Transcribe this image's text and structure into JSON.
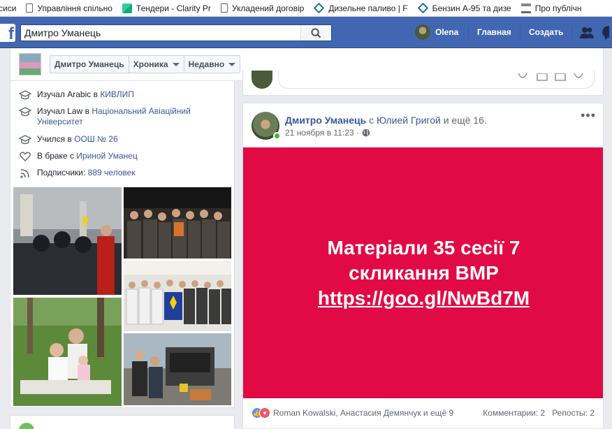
{
  "bookmarks": [
    {
      "label": "сиси",
      "icon": "none"
    },
    {
      "label": "Управління спільно",
      "icon": "doc-icon"
    },
    {
      "label": "Тендери - Clarity Pr",
      "icon": "clarity-icon"
    },
    {
      "label": "Укладений договір",
      "icon": "doc-icon"
    },
    {
      "label": "Дизельне паливо | F",
      "icon": "diamond-icon"
    },
    {
      "label": "Бензин А-95 та дизе",
      "icon": "diamond-icon"
    },
    {
      "label": "Про публічн",
      "icon": "bank-icon"
    }
  ],
  "topbar": {
    "search_value": "Дмитро Уманець",
    "user_name": "Olena",
    "home_label": "Главная",
    "create_label": "Создать"
  },
  "timeline_header": {
    "name_tab": "Дмитро Уманець",
    "chronicle_tab": "Хроника",
    "recent_tab": "Недавно"
  },
  "intro": {
    "row1_prefix": "Изучал Arabic в ",
    "row1_link": "КИВЛИП",
    "row2_prefix": "Изучал Law в ",
    "row2_link": "Національний Авіаційний Університет",
    "row3_prefix": "Учился в ",
    "row3_link": "ООШ № 26",
    "row4_prefix": "В браке с ",
    "row4_link": "Ириной Уманец",
    "row5_prefix": "Подписчики: ",
    "row5_link": "889 человек"
  },
  "post": {
    "author": "Дмитро Уманець",
    "with_text": " с ",
    "tagged": "Юлией Григой",
    "and_more": " и ещё 16.",
    "timestamp": "21 ноября в 11:23 ·",
    "banner_line1": "Матеріали 35 сесії 7",
    "banner_line2": "скликання ВМР",
    "banner_url": "https://goo.gl/NwBd7M",
    "reactors": "Roman Kowalski, Анастасия Демянчук и ещё 9",
    "comments": "Комментарии: 2",
    "shares": "Репосты: 2"
  },
  "colors": {
    "fb_blue": "#4267b2",
    "banner_red": "#e10a44",
    "link": "#385898"
  }
}
